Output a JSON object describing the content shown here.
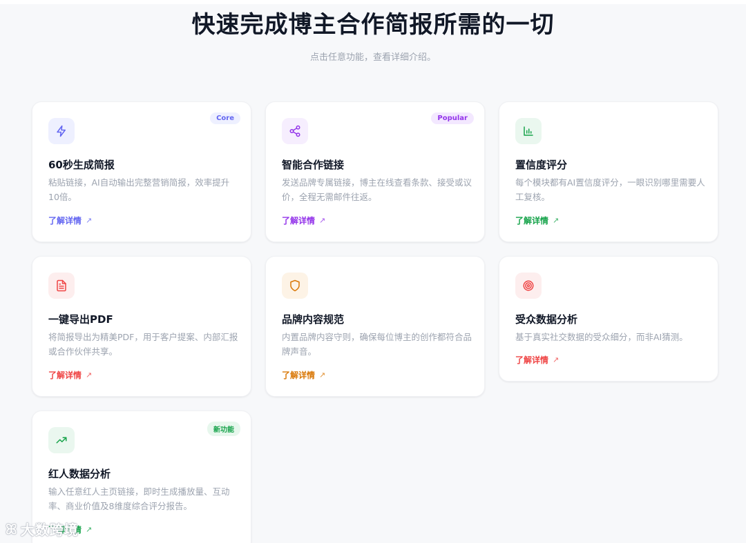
{
  "header": {
    "title": "快速完成博主合作简报所需的一切",
    "subtitle": "点击任意功能，查看详细介绍。"
  },
  "features": [
    {
      "title": "60秒生成简报",
      "desc": "粘贴链接，AI自动输出完整营销简报，效率提升10倍。",
      "link": "了解详情",
      "badge": "Core",
      "icon": "lightning-icon",
      "accent": "#6366f1",
      "icon_bg": "#eef0ff",
      "badge_bg": "#eef0ff"
    },
    {
      "title": "智能合作链接",
      "desc": "发送品牌专属链接，博主在线查看条款、接受或议价，全程无需邮件往返。",
      "link": "了解详情",
      "badge": "Popular",
      "icon": "share-icon",
      "accent": "#9333ea",
      "icon_bg": "#f6eefe",
      "badge_bg": "#f3e8ff"
    },
    {
      "title": "置信度评分",
      "desc": "每个模块都有AI置信度评分，一眼识别哪里需要人工复核。",
      "link": "了解详情",
      "badge": "",
      "icon": "bar-chart-icon",
      "accent": "#16a34a",
      "icon_bg": "#eaf7ef",
      "badge_bg": ""
    },
    {
      "title": "一键导出PDF",
      "desc": "将简报导出为精美PDF，用于客户提案、内部汇报或合作伙伴共享。",
      "link": "了解详情",
      "badge": "",
      "icon": "document-icon",
      "accent": "#ef4444",
      "icon_bg": "#fdeeee",
      "badge_bg": ""
    },
    {
      "title": "品牌内容规范",
      "desc": "内置品牌内容守则，确保每位博主的创作都符合品牌声音。",
      "link": "了解详情",
      "badge": "",
      "icon": "shield-icon",
      "accent": "#d97706",
      "icon_bg": "#fdf3e6",
      "badge_bg": ""
    },
    {
      "title": "受众数据分析",
      "desc": "基于真实社交数据的受众细分，而非AI猜测。",
      "link": "了解详情",
      "badge": "",
      "icon": "target-icon",
      "accent": "#ef4444",
      "icon_bg": "#fdeeee",
      "badge_bg": ""
    },
    {
      "title": "红人数据分析",
      "desc": "输入任意红人主页链接，即时生成播放量、互动率、商业价值及8维度综合评分报告。",
      "link": "了解详情",
      "badge": "新功能",
      "icon": "trending-up-icon",
      "accent": "#16a34a",
      "icon_bg": "#eaf7ef",
      "badge_bg": "#e7f7ed"
    }
  ],
  "watermark": {
    "text": "大数跨境"
  }
}
